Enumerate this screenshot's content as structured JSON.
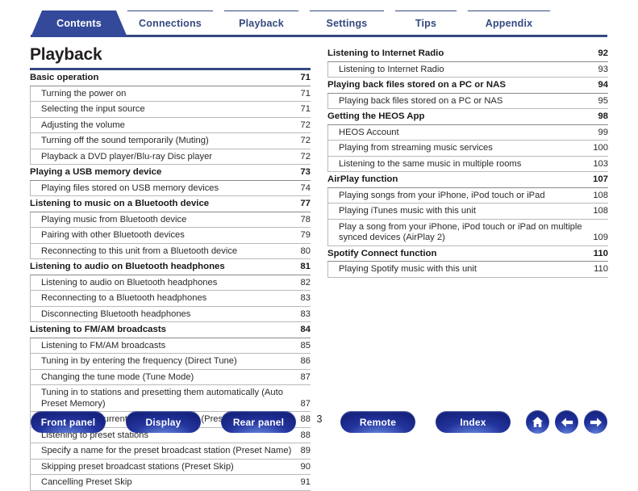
{
  "tabs": [
    {
      "label": "Contents",
      "active": true
    },
    {
      "label": "Connections",
      "active": false
    },
    {
      "label": "Playback",
      "active": false
    },
    {
      "label": "Settings",
      "active": false
    },
    {
      "label": "Tips",
      "active": false
    },
    {
      "label": "Appendix",
      "active": false
    }
  ],
  "page": {
    "title": "Playback",
    "number": "3"
  },
  "toc": {
    "left": [
      {
        "level": 1,
        "label": "Basic operation",
        "page": "71"
      },
      {
        "level": 2,
        "label": "Turning the power on",
        "page": "71"
      },
      {
        "level": 2,
        "label": "Selecting the input source",
        "page": "71"
      },
      {
        "level": 2,
        "label": "Adjusting the volume",
        "page": "72"
      },
      {
        "level": 2,
        "label": "Turning off the sound temporarily (Muting)",
        "page": "72"
      },
      {
        "level": 2,
        "label": "Playback a DVD player/Blu-ray Disc player",
        "page": "72"
      },
      {
        "level": 1,
        "label": "Playing a USB memory device",
        "page": "73"
      },
      {
        "level": 2,
        "label": "Playing files stored on USB memory devices",
        "page": "74"
      },
      {
        "level": 1,
        "label": "Listening to music on a Bluetooth device",
        "page": "77"
      },
      {
        "level": 2,
        "label": "Playing music from Bluetooth device",
        "page": "78"
      },
      {
        "level": 2,
        "label": "Pairing with other Bluetooth devices",
        "page": "79"
      },
      {
        "level": 2,
        "label": "Reconnecting to this unit from a Bluetooth device",
        "page": "80"
      },
      {
        "level": 1,
        "label": "Listening to audio on Bluetooth headphones",
        "page": "81"
      },
      {
        "level": 2,
        "label": "Listening to audio on Bluetooth headphones",
        "page": "82"
      },
      {
        "level": 2,
        "label": "Reconnecting to a Bluetooth headphones",
        "page": "83"
      },
      {
        "level": 2,
        "label": "Disconnecting Bluetooth headphones",
        "page": "83"
      },
      {
        "level": 1,
        "label": "Listening to FM/AM broadcasts",
        "page": "84"
      },
      {
        "level": 2,
        "label": "Listening to FM/AM broadcasts",
        "page": "85"
      },
      {
        "level": 2,
        "label": "Tuning in by entering the frequency (Direct Tune)",
        "page": "86"
      },
      {
        "level": 2,
        "label": "Changing the tune mode (Tune Mode)",
        "page": "87"
      },
      {
        "level": 2,
        "label": "Tuning in to stations and presetting them automatically (Auto Preset Memory)",
        "page": "87"
      },
      {
        "level": 2,
        "label": "Presetting the current broadcast station (Preset Memory)",
        "page": "88"
      },
      {
        "level": 2,
        "label": "Listening to preset stations",
        "page": "88"
      },
      {
        "level": 2,
        "label": "Specify a name for the preset broadcast station (Preset Name)",
        "page": "89"
      },
      {
        "level": 2,
        "label": "Skipping preset broadcast stations (Preset Skip)",
        "page": "90"
      },
      {
        "level": 2,
        "label": "Cancelling Preset Skip",
        "page": "91"
      }
    ],
    "right": [
      {
        "level": 1,
        "label": "Listening to Internet Radio",
        "page": "92"
      },
      {
        "level": 2,
        "label": "Listening to Internet Radio",
        "page": "93"
      },
      {
        "level": 1,
        "label": "Playing back files stored on a PC or NAS",
        "page": "94"
      },
      {
        "level": 2,
        "label": "Playing back files stored on a PC or NAS",
        "page": "95"
      },
      {
        "level": 1,
        "label": "Getting the HEOS App",
        "page": "98"
      },
      {
        "level": 2,
        "label": "HEOS Account",
        "page": "99"
      },
      {
        "level": 2,
        "label": "Playing from streaming music services",
        "page": "100"
      },
      {
        "level": 2,
        "label": "Listening to the same music in multiple rooms",
        "page": "103"
      },
      {
        "level": 1,
        "label": "AirPlay function",
        "page": "107"
      },
      {
        "level": 2,
        "label": "Playing songs from your iPhone, iPod touch or iPad",
        "page": "108"
      },
      {
        "level": 2,
        "label": "Playing iTunes music with this unit",
        "page": "108"
      },
      {
        "level": 2,
        "label": "Play a song from your iPhone, iPod touch or iPad on multiple synced devices (AirPlay 2)",
        "page": "109"
      },
      {
        "level": 1,
        "label": "Spotify Connect function",
        "page": "110"
      },
      {
        "level": 2,
        "label": "Playing Spotify music with this unit",
        "page": "110"
      }
    ]
  },
  "bottom_nav": {
    "buttons": [
      {
        "label": "Front panel",
        "cls": "pb-front",
        "name": "front-panel-button"
      },
      {
        "label": "Display",
        "cls": "pb-disp",
        "name": "display-button"
      },
      {
        "label": "Rear panel",
        "cls": "pb-rear",
        "name": "rear-panel-button"
      },
      {
        "label": "Remote",
        "cls": "pb-remote",
        "name": "remote-button"
      },
      {
        "label": "Index",
        "cls": "pb-index",
        "name": "index-button"
      }
    ],
    "icons": [
      {
        "icon": "home-icon",
        "cls": "cb-home"
      },
      {
        "icon": "arrow-left-icon",
        "cls": "cb-back"
      },
      {
        "icon": "arrow-right-icon",
        "cls": "cb-fwd"
      }
    ]
  },
  "colors": {
    "accent": "#34497f",
    "active_tab": "#34499a",
    "button_blue": "#23349c",
    "rule": "#b9b9b9"
  }
}
